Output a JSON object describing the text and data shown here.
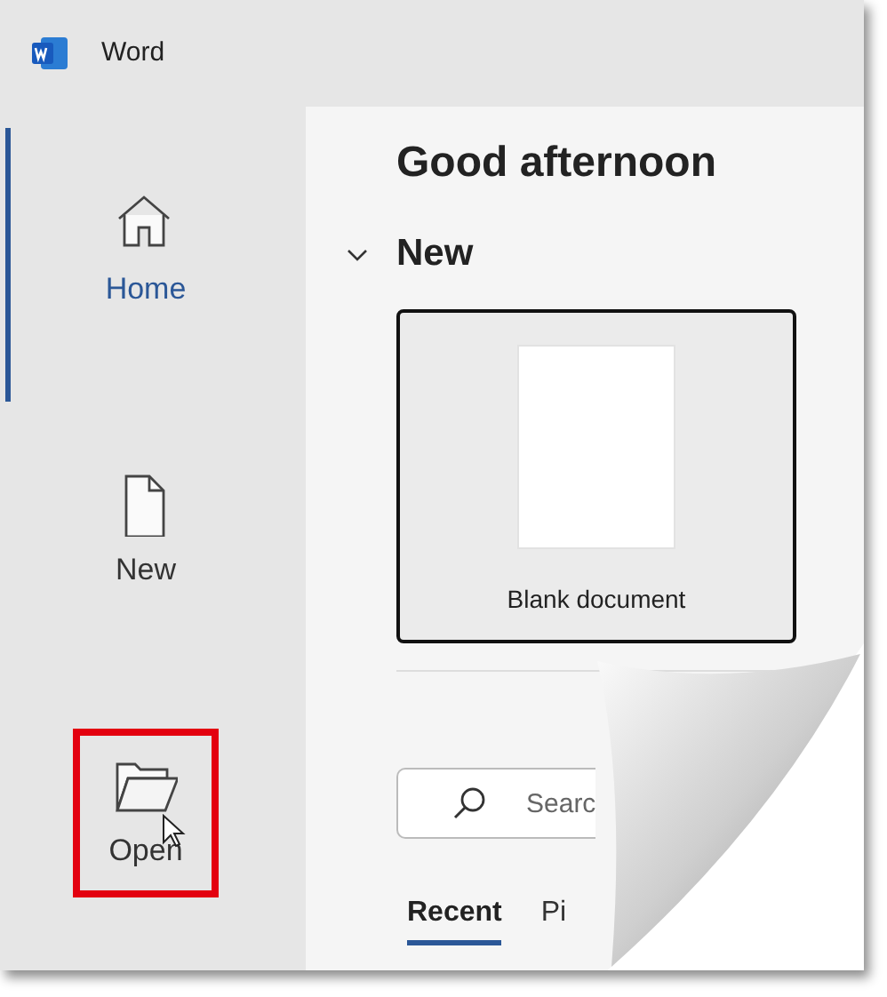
{
  "window": {
    "title": "Word"
  },
  "sidebar": {
    "items": [
      {
        "label": "Home",
        "selected": true,
        "highlighted": false
      },
      {
        "label": "New",
        "selected": false,
        "highlighted": false
      },
      {
        "label": "Open",
        "selected": false,
        "highlighted": true
      }
    ]
  },
  "greeting": "Good afternoon",
  "new_section": {
    "title": "New",
    "expanded": true,
    "templates": [
      {
        "label": "Blank document",
        "selected": true
      }
    ]
  },
  "search": {
    "placeholder": "Searc"
  },
  "tabs": [
    {
      "label": "Recent",
      "selected": true
    },
    {
      "label": "Pi",
      "selected": false
    }
  ]
}
